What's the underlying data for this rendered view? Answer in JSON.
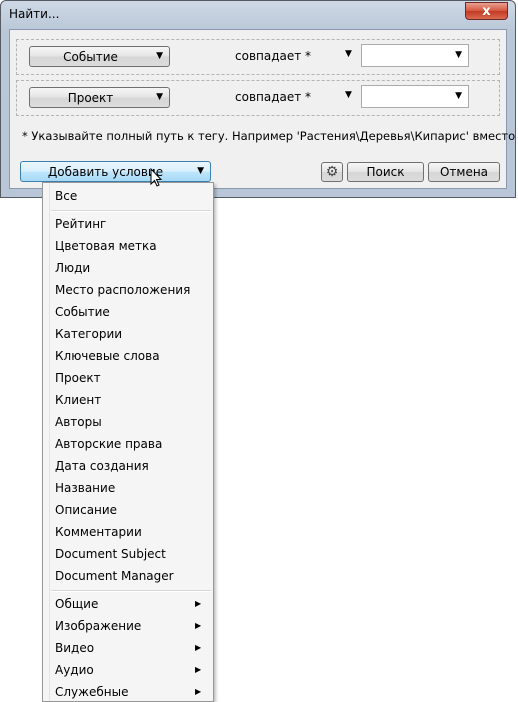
{
  "window": {
    "title": "Найти...",
    "close_glyph": "x"
  },
  "conditions": [
    {
      "field": "Событие",
      "operator": "совпадает *",
      "value": ""
    },
    {
      "field": "Проект",
      "operator": "совпадает *",
      "value": ""
    }
  ],
  "hint": "* Указывайте полный путь к тегу. Например 'Растения\\Деревья\\Кипарис' вместо",
  "buttons": {
    "add_condition": "Добавить условие",
    "search": "Поиск",
    "cancel": "Отмена"
  },
  "menu": {
    "all": "Все",
    "items": [
      "Рейтинг",
      "Цветовая метка",
      "Люди",
      "Место расположения",
      "Событие",
      "Категории",
      "Ключевые слова",
      "Проект",
      "Клиент",
      "Авторы",
      "Авторские права",
      "Дата создания",
      "Название",
      "Описание",
      "Комментарии",
      "Document Subject",
      "Document Manager"
    ],
    "submenus": [
      "Общие",
      "Изображение",
      "Видео",
      "Аудио",
      "Служебные"
    ]
  },
  "icons": {
    "dropdown": "chevron-down-icon",
    "gear": "gear-icon",
    "submenu": "chevron-right-icon"
  }
}
